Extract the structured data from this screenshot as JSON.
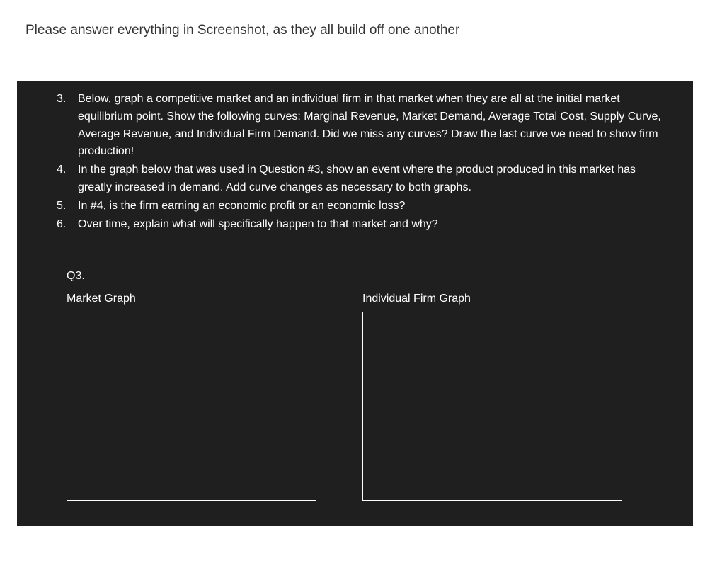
{
  "header": {
    "instruction": "Please answer everything in Screenshot, as they all build off one another"
  },
  "questions": [
    {
      "num": "3.",
      "text": "Below, graph a competitive market and an individual firm in that market when they are all at the initial market equilibrium point. Show the following curves: Marginal Revenue, Market Demand, Average Total Cost, Supply Curve, Average Revenue, and Individual Firm Demand. Did we miss any curves?  Draw the last curve we need to show firm production!"
    },
    {
      "num": "4.",
      "text": "In the graph below that was used in Question #3, show an event where the product produced in this market has greatly increased in demand.  Add curve changes as necessary to both graphs."
    },
    {
      "num": "5.",
      "text": "In #4, is the firm earning an economic profit or an economic loss?"
    },
    {
      "num": "6.",
      "text": "Over time, explain what will specifically happen to that market and why?"
    }
  ],
  "section": {
    "label": "Q3."
  },
  "graphs": {
    "market_title": "Market Graph",
    "firm_title": "Individual Firm Graph"
  }
}
